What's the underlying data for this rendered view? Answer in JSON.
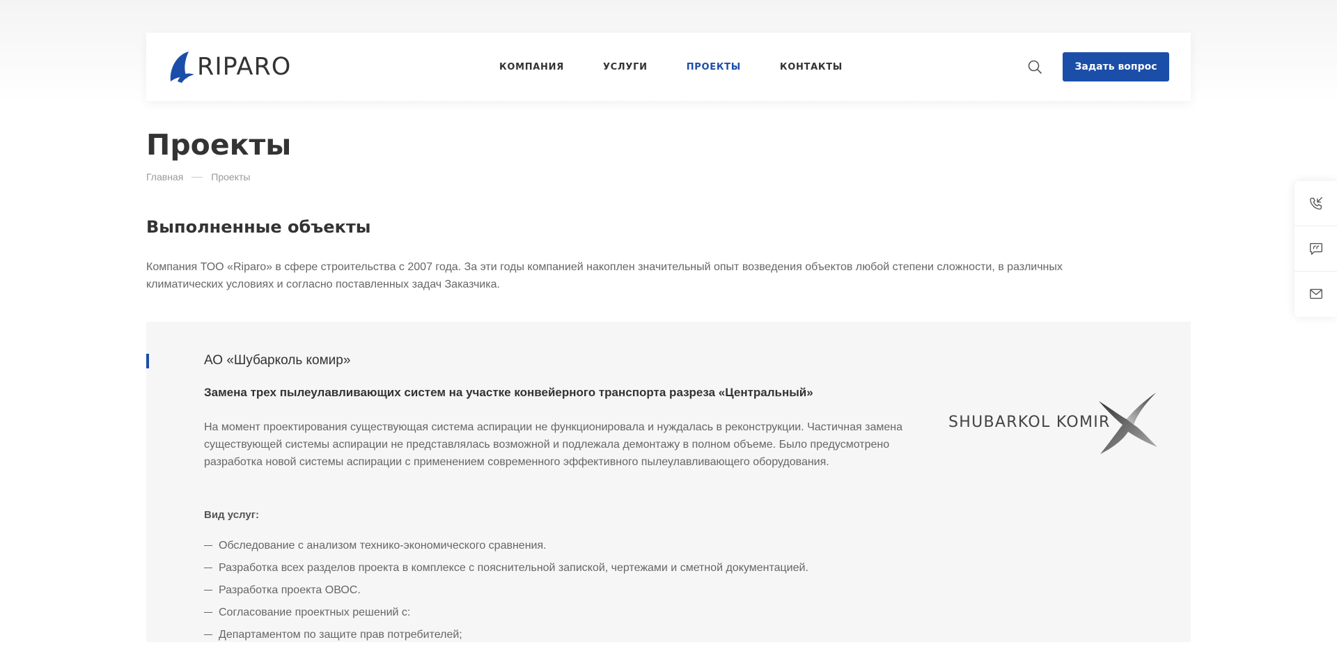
{
  "header": {
    "logo_text": "RIPARO",
    "nav": [
      {
        "label": "КОМПАНИЯ",
        "active": false
      },
      {
        "label": "УСЛУГИ",
        "active": false
      },
      {
        "label": "ПРОЕКТЫ",
        "active": true
      },
      {
        "label": "КОНТАКТЫ",
        "active": false
      }
    ],
    "search_icon": "search-icon",
    "ask_button": "Задать вопрос"
  },
  "page": {
    "title": "Проекты",
    "breadcrumb": [
      "Главная",
      "Проекты"
    ],
    "section_title": "Выполненные объекты",
    "intro": "Компания ТОО «Riparo» в сфере строительства с 2007 года. За эти годы компанией накоплен значительный опыт возведения объектов любой степени сложности, в различных климатических условиях и согласно поставленных задач Заказчика."
  },
  "project": {
    "client": "АО «Шубарколь комир»",
    "title": "Замена трех пылеулавливающих систем на участке конвейерного транспорта разреза «Центральный»",
    "description": "На момент проектирования существующая система аспирации не функционировала и нуждалась в реконструкции. Частичная замена существующей системы аспирации не представлялась возможной и подлежала демонтажу в полном объеме. Было предусмотрено разработка новой системы аспирации с применением современного эффективного пылеулавливающего оборудования.",
    "services_label": "Вид услуг:",
    "services": [
      "Обследование с анализом технико-экономического сравнения.",
      "Разработка всех разделов проекта в комплексе с пояснительной запиской, чертежами и сметной документацией.",
      "Разработка проекта ОВОС.",
      "Согласование проектных решений с:",
      "Департаментом по защите прав потребителей;"
    ],
    "client_logo_text": "SHUBARKOL KOMIR"
  },
  "side_panel": {
    "icons": [
      "phone-callback-icon",
      "chat-icon",
      "mail-icon"
    ]
  },
  "colors": {
    "accent": "#1b4ea8",
    "text": "#333333",
    "muted_text": "#666666",
    "card_bg": "#f6f6f6"
  }
}
